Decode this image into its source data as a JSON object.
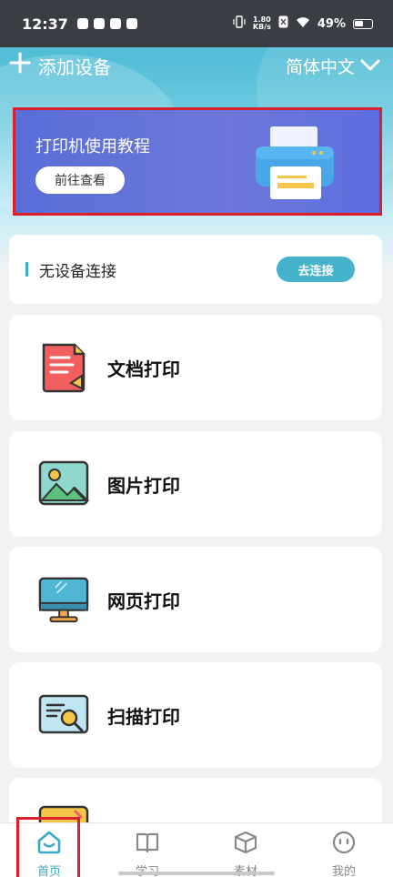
{
  "status_bar": {
    "time": "12:37",
    "net_speed_value": "1.80",
    "net_speed_unit": "KB/s",
    "battery": "49%"
  },
  "header": {
    "add_device": "添加设备",
    "language": "简体中文"
  },
  "banner": {
    "title": "打印机使用教程",
    "button": "前往查看"
  },
  "device": {
    "status": "无设备连接",
    "connect_button": "去连接"
  },
  "features": [
    {
      "label": "文档打印",
      "icon": "document-icon"
    },
    {
      "label": "图片打印",
      "icon": "picture-icon"
    },
    {
      "label": "网页打印",
      "icon": "monitor-icon"
    },
    {
      "label": "扫描打印",
      "icon": "scan-icon"
    },
    {
      "label": "",
      "icon": "partial-icon"
    }
  ],
  "bottom_nav": [
    {
      "label": "首页",
      "icon": "home-icon",
      "active": true
    },
    {
      "label": "学习",
      "icon": "book-icon",
      "active": false
    },
    {
      "label": "素材",
      "icon": "box-icon",
      "active": false
    },
    {
      "label": "我的",
      "icon": "face-icon",
      "active": false
    }
  ],
  "colors": {
    "accent": "#3aa9c8",
    "banner": "#5a6ed8",
    "highlight_border": "#d8212b"
  }
}
